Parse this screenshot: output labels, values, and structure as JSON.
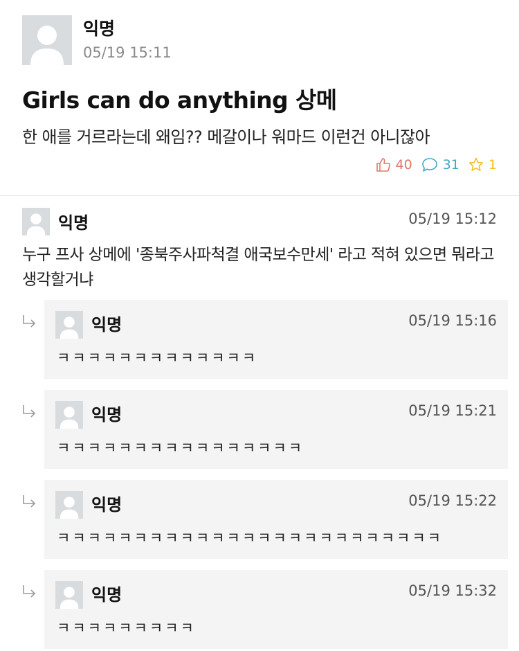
{
  "post": {
    "author": "익명",
    "time": "05/19 15:11",
    "title": "Girls can do anything 상메",
    "body": "한 애를 거르라는데 왜임?? 메갈이나 워마드 이런건 아니잖아",
    "likes": "40",
    "comments": "31",
    "scraps": "1"
  },
  "comment": {
    "author": "익명",
    "time": "05/19 15:12",
    "text": "누구 프사 상메에 '종북주사파척결 애국보수만세' 라고 적혀 있으면 뭐라고 생각할거냐"
  },
  "replies": [
    {
      "author": "익명",
      "time": "05/19 15:16",
      "text": "ㅋㅋㅋㅋㅋㅋㅋㅋㅋㅋㅋㅋㅋ"
    },
    {
      "author": "익명",
      "time": "05/19 15:21",
      "text": "ㅋㅋㅋㅋㅋㅋㅋㅋㅋㅋㅋㅋㅋㅋㅋㅋ"
    },
    {
      "author": "익명",
      "time": "05/19 15:22",
      "text": "ㅋㅋㅋㅋㅋㅋㅋㅋㅋㅋㅋㅋㅋㅋㅋㅋㅋㅋㅋㅋㅋㅋㅋㅋㅋ"
    },
    {
      "author": "익명",
      "time": "05/19 15:32",
      "text": "ㅋㅋㅋㅋㅋㅋㅋㅋㅋ"
    }
  ],
  "icons": {
    "avatar": "default-user-avatar-icon",
    "like": "thumbs-up-icon",
    "comment": "speech-bubble-icon",
    "scrap": "star-icon",
    "reply": "reply-arrow-icon"
  },
  "colors": {
    "like": "#e0766a",
    "comment": "#3fa7c2",
    "scrap": "#f2c019",
    "reply_background": "#f4f4f4"
  }
}
